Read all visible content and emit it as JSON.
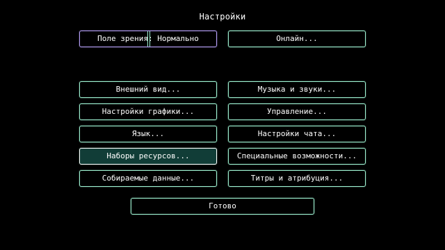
{
  "screen": {
    "title": "Настройки"
  },
  "fov": {
    "label": "Поле зрения: Нормально"
  },
  "online": {
    "label": "Онлайн..."
  },
  "buttons": {
    "skin": "Внешний вид...",
    "music": "Музыка и звуки...",
    "video": "Настройки графики...",
    "controls": "Управление...",
    "language": "Язык...",
    "chat": "Настройки чата...",
    "resource_packs": "Наборы ресурсов...",
    "accessibility": "Специальные возможности...",
    "telemetry": "Собираемые данные...",
    "credits": "Титры и атрибуция..."
  },
  "done": {
    "label": "Готово"
  },
  "colors": {
    "background": "#000000",
    "button_border": "#9ef2d2",
    "slider_border": "#b49ef5",
    "selected_fill": "#113d37",
    "text": "#ffffff"
  },
  "icons": {
    "slider_handle": "slider-handle-icon"
  }
}
